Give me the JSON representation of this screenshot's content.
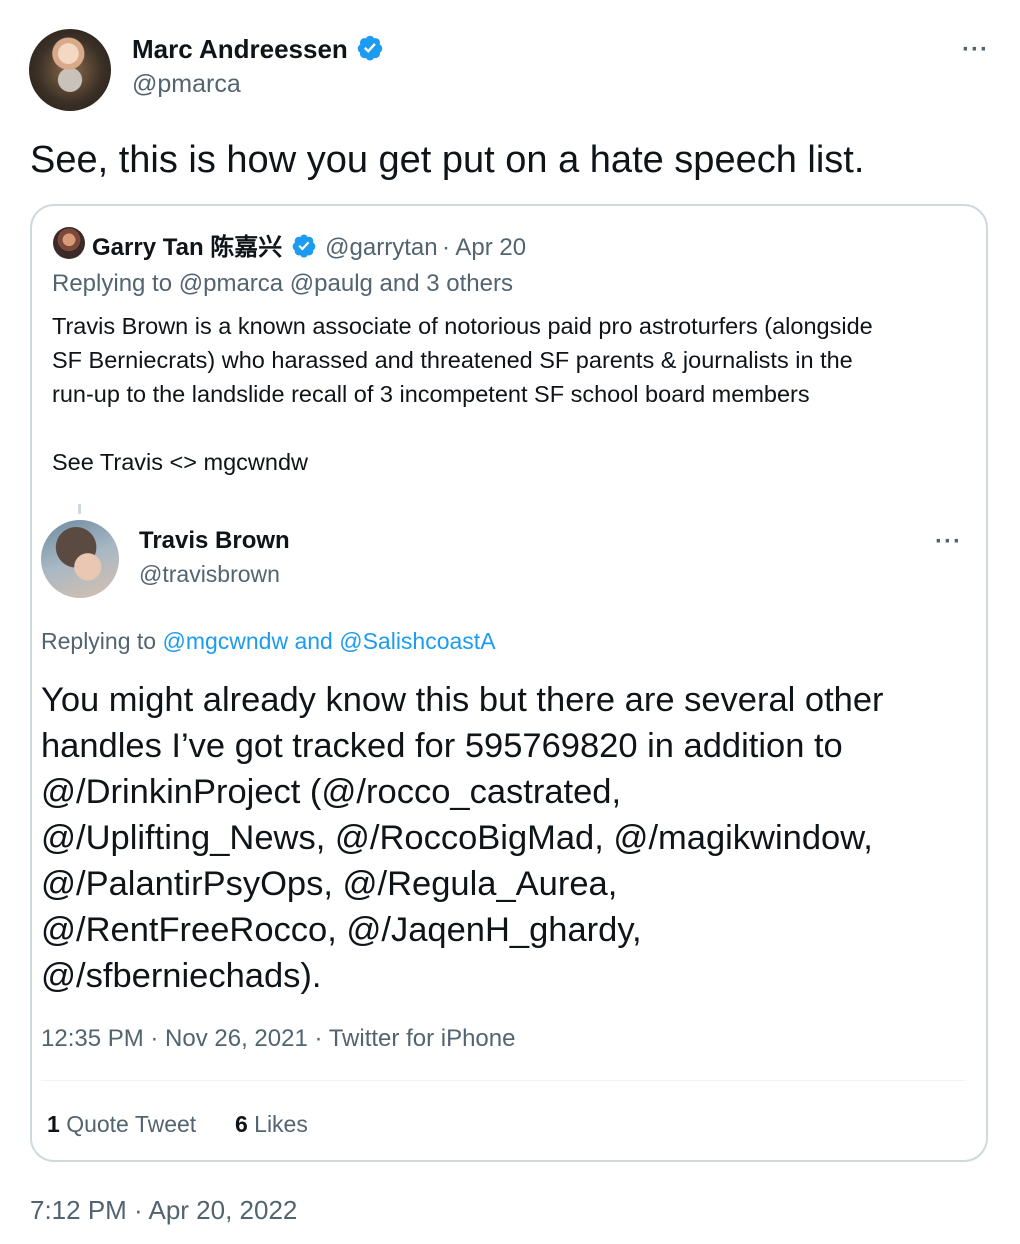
{
  "tweet": {
    "author_name": "Marc Andreessen",
    "author_handle": "@pmarca",
    "more_label": "···",
    "text": "See, this is how you get put on a hate speech list.",
    "timestamp": "7:12 PM · Apr 20, 2022"
  },
  "quote": {
    "author_name": "Garry Tan 陈嘉兴",
    "author_handle": "@garrytan",
    "date": "· Apr 20",
    "replying_to": "Replying to @pmarca @paulg and 3 others",
    "text_lines": [
      "Travis Brown is a known associate of notorious paid pro astroturfers (alongside",
      "SF Berniecrats) who harassed and threatened SF parents & journalists in the",
      "run-up to the landslide recall of 3 incompetent SF school board members"
    ],
    "text_line_4": "See Travis <> mgcwndw"
  },
  "embedded": {
    "author_name": "Travis Brown",
    "author_handle": "@travisbrown",
    "more_label": "···",
    "replying_prefix": "Replying to",
    "replying_users": "@mgcwndw and @SalishcoastA",
    "text_lines": [
      "You might already know this but there are several other",
      "handles I’ve got tracked for 595769820 in addition to",
      "@/DrinkinProject (@/rocco_castrated,",
      "@/Uplifting_News, @/RoccoBigMad, @/magikwindow,",
      "@/PalantirPsyOps, @/Regula_Aurea,",
      "@/RentFreeRocco, @/JaqenH_ghardy,",
      "@/sfberniechads)."
    ],
    "meta": "12:35 PM · Nov 26, 2021 · Twitter for iPhone",
    "quote_tweets_count": "1",
    "quote_tweets_label": "Quote Tweet",
    "likes_count": "6",
    "likes_label": "Likes"
  },
  "colors": {
    "verified": "#1d9bf0",
    "link": "#1d9bf0",
    "secondary_text": "#536471",
    "border": "#cfd9de"
  }
}
